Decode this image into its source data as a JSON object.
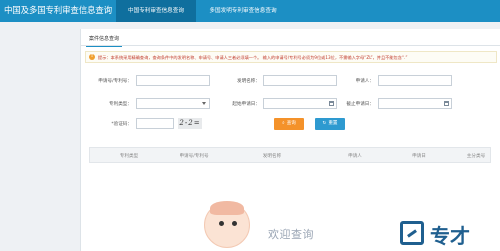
{
  "header": {
    "title": "中国及多国专利审查信息查询",
    "tabs": [
      {
        "label": "中国专利审查信息查询",
        "active": true
      },
      {
        "label": "多国发明专利审查信息查询",
        "active": false
      }
    ]
  },
  "panel": {
    "tab_label": "案件信息查询",
    "notice_icon": "!",
    "notice": "提示：本系统采用精确查询，查询条件中的发明名称、申请号、申请人三者必须填一个。 输入的申请号/专利号必须为9位或13位，不需输入字母“ZL”，并且不能包含“.”"
  },
  "form": {
    "labels": {
      "app_no": "申请号/专利号：",
      "invention_name": "发明名称：",
      "applicant": "申请人：",
      "patent_type": "专利类型：",
      "start_date": "起始申请日：",
      "end_date": "截止申请日：",
      "captcha": "*验证码："
    },
    "values": {
      "app_no": "",
      "invention_name": "",
      "applicant": "",
      "patent_type": "",
      "start_date": "",
      "end_date": "",
      "captcha": ""
    },
    "captcha_image_text": "2-2=",
    "query_button": "查询",
    "reset_button": "重置"
  },
  "table": {
    "columns": [
      "专利类型",
      "申请号/专利号",
      "发明名称",
      "申请人",
      "申请日",
      "主分类号"
    ]
  },
  "welcome": "欢迎查询",
  "brand": {
    "name": "专才",
    "color": "#1f5f8f"
  },
  "colors": {
    "header": "#1c8fc4",
    "active_tab": "#0f6f9e",
    "query_button": "#f4922a",
    "reset_button": "#2e9ad0",
    "notice_text": "#c0392b"
  }
}
